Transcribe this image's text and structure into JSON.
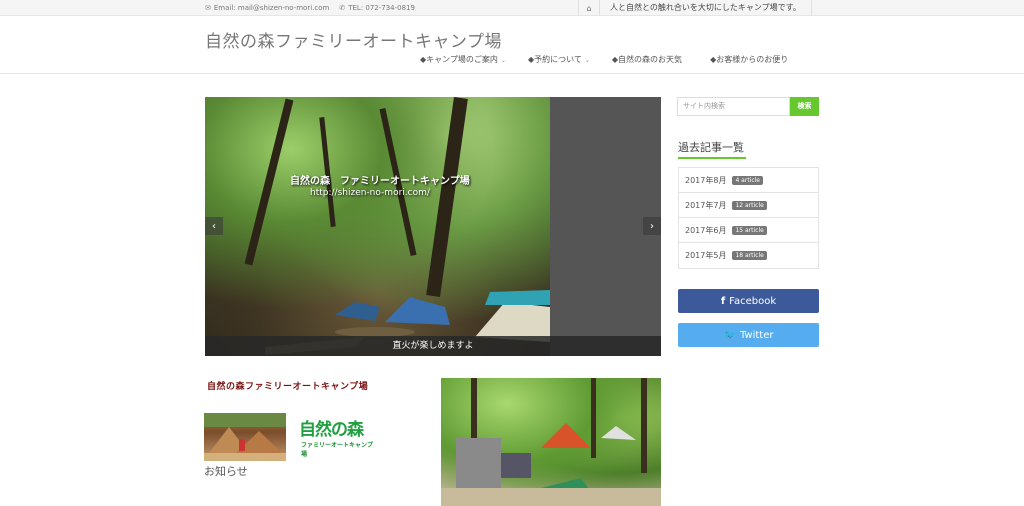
{
  "topbar": {
    "email": "Email: mail@shizen-no-mori.com",
    "tel": "TEL: 072-734-0819",
    "tagline": "人と自然との触れ合いを大切にしたキャンプ場です。"
  },
  "header": {
    "site_title": "自然の森ファミリーオートキャンプ場",
    "nav": [
      {
        "label": "◆キャンプ場のご案内",
        "has_dropdown": true
      },
      {
        "label": "◆予約について",
        "has_dropdown": true
      },
      {
        "label": "◆自然の森のお天気",
        "has_dropdown": false
      },
      {
        "label": "◆お客様からのお便り",
        "has_dropdown": false
      }
    ]
  },
  "slider": {
    "overlay_title": "自然の森　ファミリーオートキャンプ場",
    "overlay_url": "http://shizen-no-mori.com/",
    "caption": "直火が楽しめますよ",
    "prev_icon": "chevron-left-icon",
    "next_icon": "chevron-right-icon"
  },
  "content": {
    "section_title": "自然の森ファミリーオートキャンプ場",
    "logo_text": "自然の森",
    "logo_sub": "ファミリーオートキャンプ場",
    "notice_label": "お知らせ"
  },
  "sidebar": {
    "search_placeholder": "サイト内検索",
    "search_button": "検索",
    "archive_title": "過去記事一覧",
    "archives": [
      {
        "month": "2017年8月",
        "count": "4 article"
      },
      {
        "month": "2017年7月",
        "count": "12 article"
      },
      {
        "month": "2017年6月",
        "count": "15 article"
      },
      {
        "month": "2017年5月",
        "count": "18 article"
      }
    ],
    "facebook_label": "Facebook",
    "twitter_label": "Twitter"
  },
  "colors": {
    "accent": "#66c82c",
    "facebook": "#3c5a99",
    "twitter": "#55acee",
    "section_title": "#7a1010"
  }
}
